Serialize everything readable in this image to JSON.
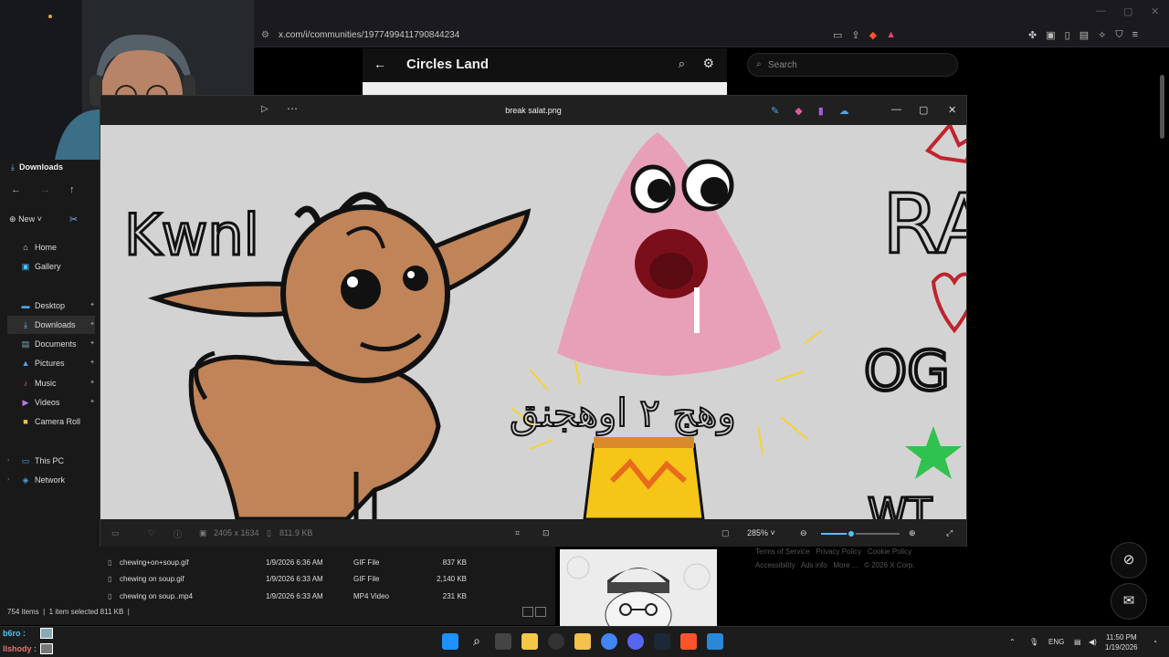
{
  "browser": {
    "url": "x.com/i/communities/1977499411790844234",
    "community_title": "Circles Land",
    "search_placeholder": "Search",
    "footer_links": [
      "Terms of Service",
      "Privacy Policy",
      "Cookie Policy",
      "Accessibility",
      "Ads info",
      "More ...",
      "© 2026 X Corp."
    ]
  },
  "explorer": {
    "title": "Downloads",
    "new_label": "New",
    "sidebar": [
      {
        "label": "Home",
        "icon": "home-icon"
      },
      {
        "label": "Gallery",
        "icon": "gallery-icon"
      },
      {
        "label": "Desktop",
        "icon": "desktop-icon",
        "pinned": true
      },
      {
        "label": "Downloads",
        "icon": "downloads-icon",
        "pinned": true
      },
      {
        "label": "Documents",
        "icon": "documents-icon",
        "pinned": true
      },
      {
        "label": "Pictures",
        "icon": "pictures-icon",
        "pinned": true
      },
      {
        "label": "Music",
        "icon": "music-icon",
        "pinned": true
      },
      {
        "label": "Videos",
        "icon": "videos-icon",
        "pinned": true
      },
      {
        "label": "Camera Roll",
        "icon": "folder-icon"
      },
      {
        "label": "This PC",
        "icon": "pc-icon"
      },
      {
        "label": "Network",
        "icon": "network-icon"
      }
    ],
    "files": [
      {
        "name": "chewing+on+soup.gif",
        "date": "1/9/2026 6:36 AM",
        "type": "GIF File",
        "size": "837 KB"
      },
      {
        "name": "chewing on soup.gif",
        "date": "1/9/2026 6:33 AM",
        "type": "GIF File",
        "size": "2,140 KB"
      },
      {
        "name": "chewing on soup..mp4",
        "date": "1/9/2026 6:33 AM",
        "type": "MP4 Video",
        "size": "231 KB"
      }
    ],
    "status_items": "754 items",
    "status_selected": "1 item selected  811 KB"
  },
  "viewer": {
    "file_name": "break salat.png",
    "dimensions": "2405 x 1634",
    "file_size": "811.9 KB",
    "zoom_label": "285%",
    "zoom_fraction": 0.38,
    "drawing_texts": {
      "kwnl": "Kwnl",
      "arabic": "وهج ٢ اوهجنق",
      "ra": "RA",
      "og": "OG",
      "wt": "WT"
    }
  },
  "taskbar": {
    "chat_user1": "b6ro :",
    "chat_user2": "llshody :",
    "lang": "ENG",
    "time": "11:50 PM",
    "date": "1/19/2026"
  }
}
